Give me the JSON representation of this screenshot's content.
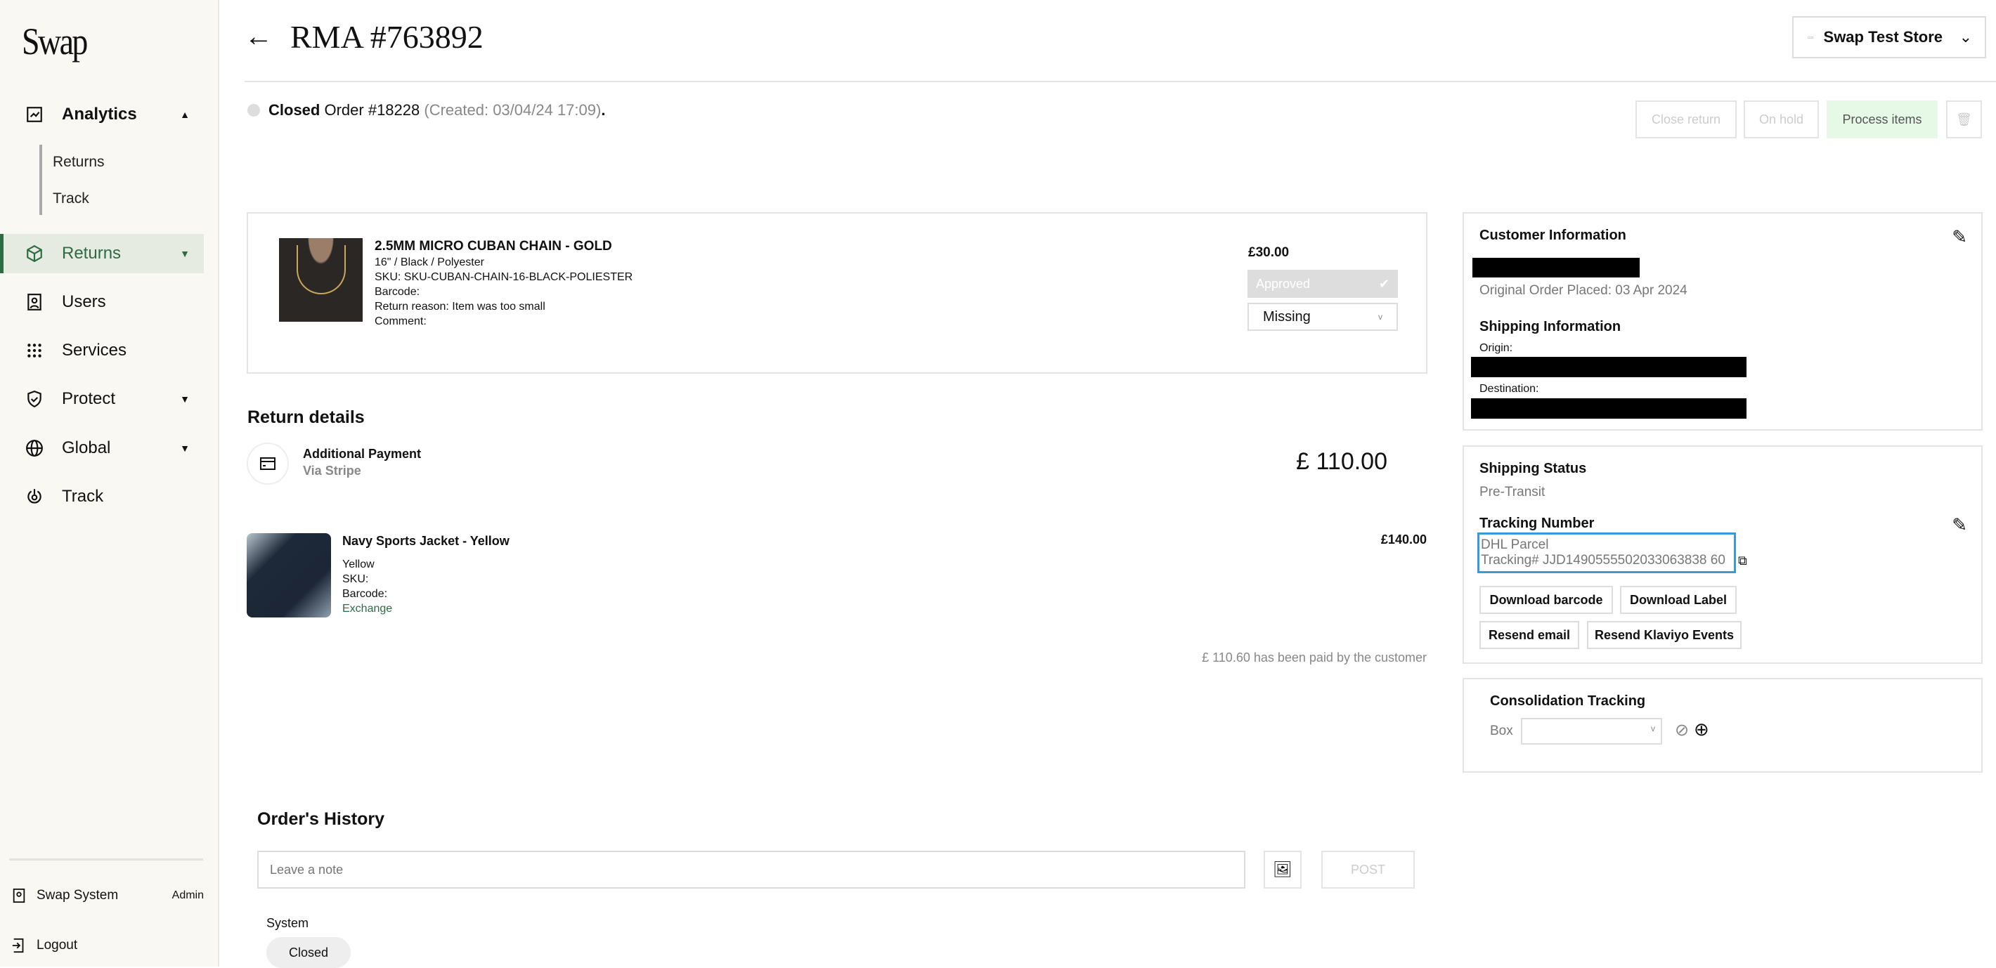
{
  "sidebar": {
    "logo": "Swap",
    "analytics": "Analytics",
    "analytics_sub": [
      "Returns",
      "Track"
    ],
    "items": [
      {
        "label": "Returns",
        "icon": "package-icon"
      },
      {
        "label": "Users",
        "icon": "user-badge-icon"
      },
      {
        "label": "Services",
        "icon": "grid-dots-icon"
      },
      {
        "label": "Protect",
        "icon": "shield-check-icon"
      },
      {
        "label": "Global",
        "icon": "globe-icon"
      },
      {
        "label": "Track",
        "icon": "track-icon"
      }
    ],
    "account": "Swap System",
    "role": "Admin",
    "logout": "Logout"
  },
  "header": {
    "title": "RMA #763892",
    "store": "Swap Test Store"
  },
  "status": {
    "state": "Closed",
    "order": "Order #18228",
    "created": "(Created: 03/04/24 17:09)",
    "dot": "."
  },
  "actions": {
    "close": "Close return",
    "hold": "On hold",
    "process": "Process items"
  },
  "item": {
    "name": "2.5MM MICRO CUBAN CHAIN - GOLD",
    "variant": "16\" / Black / Polyester",
    "sku": "SKU: SKU-CUBAN-CHAIN-16-BLACK-POLIESTER",
    "barcode": "Barcode:",
    "reason": "Return reason: Item was too small",
    "comment": "Comment:",
    "price": "£30.00",
    "approved": "Approved",
    "condition": "Missing"
  },
  "return_details": {
    "title": "Return details",
    "payment_label": "Additional Payment",
    "payment_via": "Via Stripe",
    "payment_amount": "£ 110.00",
    "exchange": {
      "name": "Navy Sports Jacket - Yellow",
      "variant": "Yellow",
      "sku": "SKU:",
      "barcode": "Barcode:",
      "type": "Exchange",
      "price": "£140.00"
    },
    "paid_note": "£ 110.60 has been paid by the customer"
  },
  "customer": {
    "title": "Customer Information",
    "placed": "Original Order Placed: 03 Apr 2024",
    "shipping_title": "Shipping Information",
    "origin": "Origin:",
    "destination": "Destination:"
  },
  "shipping": {
    "title": "Shipping Status",
    "status": "Pre-Transit",
    "tracking_title": "Tracking Number",
    "carrier": "DHL Parcel",
    "tracking": "Tracking# JJD1490555502033063838 60",
    "buttons": [
      "Download barcode",
      "Download Label",
      "Resend email",
      "Resend Klaviyo Events"
    ]
  },
  "consolidation": {
    "title": "Consolidation Tracking",
    "box_label": "Box"
  },
  "history": {
    "title": "Order's History",
    "placeholder": "Leave a note",
    "post": "POST",
    "author": "System",
    "event": "Closed"
  },
  "colors": {
    "accent": "#2e6b45",
    "process_bg": "#e6f8e6",
    "sidebar_bg": "#faf8f2"
  }
}
